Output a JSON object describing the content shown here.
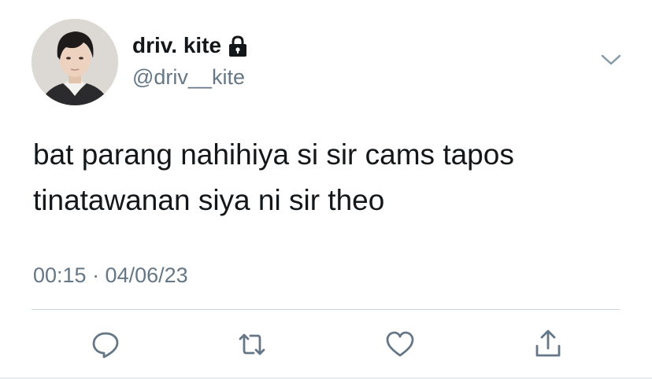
{
  "user": {
    "display_name": "driv. kite",
    "handle": "@driv__kite",
    "protected_icon": "lock-icon",
    "avatar_icon": "profile-photo"
  },
  "tweet": {
    "text": "bat parang nahihiya si sir cams tapos tinatawanan siya ni sir theo",
    "timestamp": "00:15 · 04/06/23"
  },
  "actions": [
    {
      "name": "reply",
      "icon": "speech-bubble-icon"
    },
    {
      "name": "retweet",
      "icon": "retweet-arrows-icon"
    },
    {
      "name": "like",
      "icon": "heart-icon"
    },
    {
      "name": "share",
      "icon": "share-upload-icon"
    }
  ],
  "menu": {
    "icon": "chevron-down-icon"
  },
  "colors": {
    "text": "#14171a",
    "secondary": "#657786",
    "icon": "#657786",
    "divider": "#ccd6dd"
  }
}
